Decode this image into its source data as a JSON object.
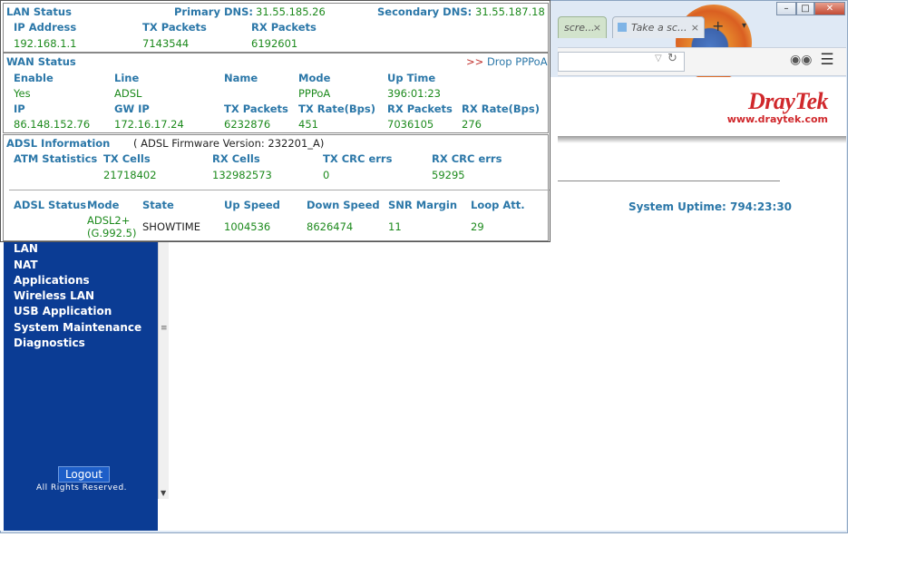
{
  "browser": {
    "tabs": [
      {
        "label": "scre...",
        "close": "×"
      },
      {
        "label": "Take a sc...",
        "close": "×"
      }
    ],
    "new_tab": "+",
    "window_controls": {
      "minimize": "–",
      "maximize": "□",
      "close": "✕"
    },
    "menu_icon": "☰"
  },
  "header": {
    "brand_logo": "DrayTek",
    "brand_url": "www.draytek.com",
    "system_uptime_label": "System Uptime:",
    "system_uptime_value": "794:23:30"
  },
  "sidebar": {
    "items": [
      "LAN",
      "NAT",
      "Applications",
      "Wireless LAN",
      "USB Application",
      "System Maintenance",
      "Diagnostics"
    ],
    "logout": "Logout",
    "rights": "All Rights Reserved."
  },
  "lan": {
    "title": "LAN Status",
    "primary_dns_label": "Primary DNS:",
    "primary_dns": "31.55.185.26",
    "secondary_dns_label": "Secondary DNS:",
    "secondary_dns": "31.55.187.18",
    "headers": [
      "IP Address",
      "TX Packets",
      "RX Packets"
    ],
    "values": [
      "192.168.1.1",
      "7143544",
      "6192601"
    ]
  },
  "wan": {
    "title": "WAN Status",
    "drop_arrows": ">>",
    "drop_label": "Drop PPPoA",
    "headers1": [
      "Enable",
      "Line",
      "Name",
      "Mode",
      "Up Time"
    ],
    "values1": [
      "Yes",
      "ADSL",
      "",
      "PPPoA",
      "396:01:23"
    ],
    "headers2": [
      "IP",
      "GW IP",
      "TX Packets",
      "TX Rate(Bps)",
      "RX Packets",
      "RX Rate(Bps)"
    ],
    "values2": [
      "86.148.152.76",
      "172.16.17.24",
      "6232876",
      "451",
      "7036105",
      "276"
    ]
  },
  "adsl": {
    "title": "ADSL Information",
    "firmware_label": "( ADSL Firmware Version:",
    "firmware_value": "232201_A)",
    "atm_headers": [
      "ATM Statistics",
      "TX Cells",
      "RX Cells",
      "TX CRC errs",
      "RX CRC errs"
    ],
    "atm_values": [
      "21718402",
      "132982573",
      "0",
      "59295"
    ],
    "status_headers": [
      "ADSL Status",
      "Mode",
      "State",
      "Up Speed",
      "Down Speed",
      "SNR Margin",
      "Loop Att."
    ],
    "mode_line1": "ADSL2+",
    "mode_line2": "(G.992.5)",
    "status_values": [
      "SHOWTIME",
      "1004536",
      "8626474",
      "11",
      "29"
    ]
  }
}
